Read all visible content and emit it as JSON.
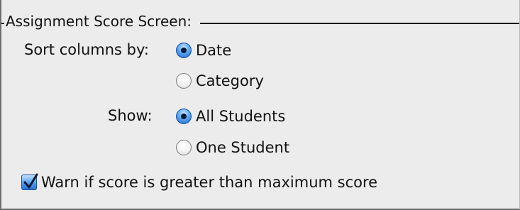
{
  "group": {
    "title": "Assignment Score Screen:"
  },
  "sort_columns": {
    "label": "Sort columns by:",
    "options": [
      {
        "label": "Date",
        "selected": true
      },
      {
        "label": "Category",
        "selected": false
      }
    ]
  },
  "show": {
    "label": "Show:",
    "options": [
      {
        "label": "All Students",
        "selected": true
      },
      {
        "label": "One Student",
        "selected": false
      }
    ]
  },
  "warn_checkbox": {
    "label": "Warn if score is greater than maximum score",
    "checked": true
  },
  "colors": {
    "accent": "#2b73d3",
    "window_bg": "#ececec"
  }
}
